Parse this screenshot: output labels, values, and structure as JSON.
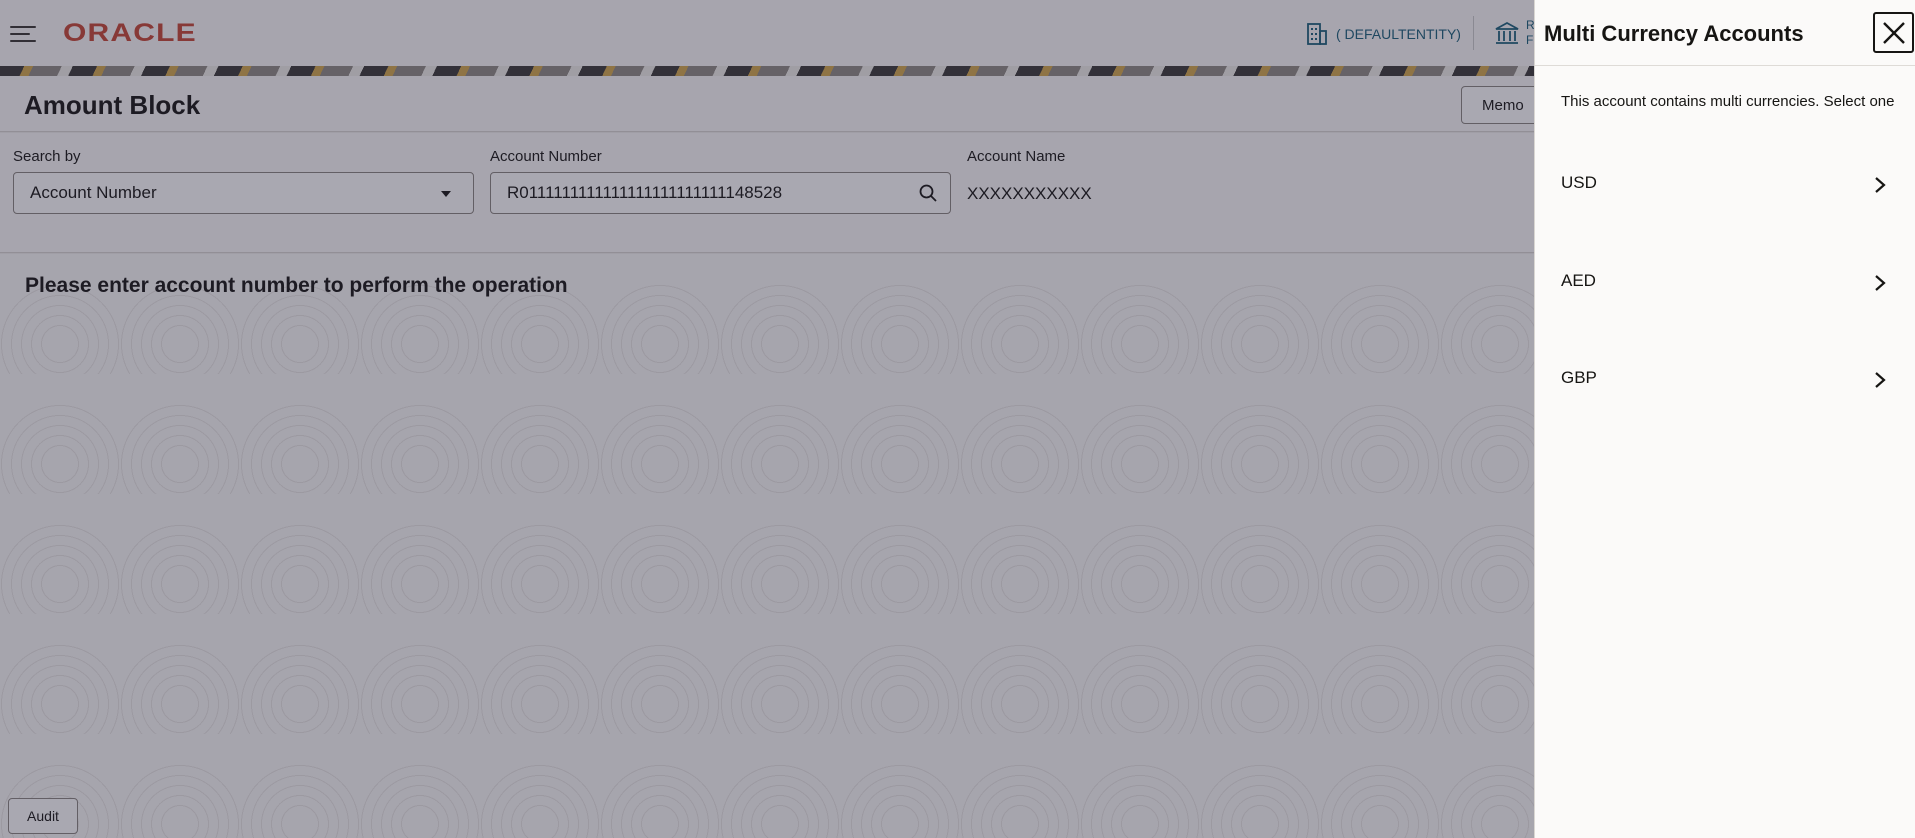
{
  "topbar": {
    "logo": "ORACLE",
    "entity": "( DEFAULTENTITY)",
    "bank_line1": "R",
    "bank_line2": "F"
  },
  "page": {
    "title": "Amount Block",
    "memo_label": "Memo",
    "message": "Please enter account number to perform the operation",
    "audit_label": "Audit"
  },
  "search": {
    "search_by_label": "Search by",
    "search_by_value": "Account Number",
    "account_number_label": "Account Number",
    "account_number_value": "R0111111111111111111111111148528",
    "account_name_label": "Account Name",
    "account_name_value": "XXXXXXXXXXX"
  },
  "drawer": {
    "title": "Multi Currency Accounts",
    "description": "This account contains multi currencies. Select one",
    "currencies": [
      {
        "code": "USD"
      },
      {
        "code": "AED"
      },
      {
        "code": "GBP"
      }
    ]
  },
  "colors": {
    "brand": "#c74634",
    "link": "#1a5f7a",
    "overlay": "#28263c"
  },
  "icons": {
    "menu": "hamburger-icon",
    "entity": "building-icon",
    "bank": "bank-icon",
    "search": "search-icon",
    "close": "close-icon",
    "chevron": "chevron-right-icon"
  }
}
